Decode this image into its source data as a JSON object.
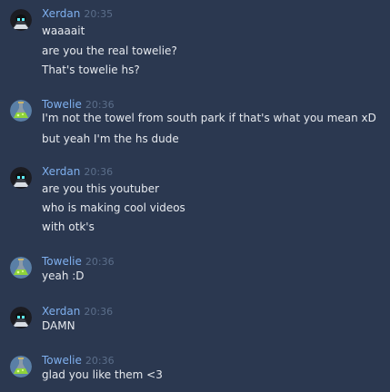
{
  "messages": [
    {
      "user": "Xerdan",
      "time": "20:35",
      "avatar_icon": "dark-robot-avatar",
      "lines": [
        "waaaait",
        "are you the real towelie?",
        "That's towelie hs?"
      ]
    },
    {
      "user": "Towelie",
      "time": "20:36",
      "avatar_icon": "green-flask-avatar",
      "lines": [
        "I'm not the towel from south park if that's what you mean xD",
        "but yeah I'm the hs dude"
      ]
    },
    {
      "user": "Xerdan",
      "time": "20:36",
      "avatar_icon": "dark-robot-avatar",
      "lines": [
        "are you this youtuber",
        "who is making cool videos",
        "with otk's"
      ]
    },
    {
      "user": "Towelie",
      "time": "20:36",
      "avatar_icon": "green-flask-avatar",
      "lines": [
        "yeah :D"
      ]
    },
    {
      "user": "Xerdan",
      "time": "20:36",
      "avatar_icon": "dark-robot-avatar",
      "lines": [
        "DAMN"
      ]
    },
    {
      "user": "Towelie",
      "time": "20:36",
      "avatar_icon": "green-flask-avatar",
      "lines": [
        "glad you like them <3"
      ]
    }
  ],
  "colors": {
    "background": "#2b3850",
    "username": "#7fb0ef",
    "timestamp": "#5b6e8a",
    "message_text": "#e6e9ee"
  }
}
